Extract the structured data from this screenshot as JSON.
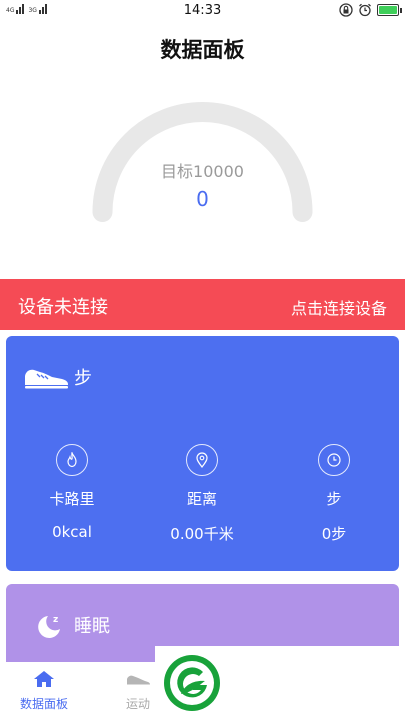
{
  "status_bar": {
    "network_labels": [
      "4G",
      "3G"
    ],
    "time": "14:33"
  },
  "header": {
    "title": "数据面板"
  },
  "gauge": {
    "target_label": "目标10000",
    "current_value": "0",
    "progress": 0
  },
  "connection": {
    "status": "设备未连接",
    "action": "点击连接设备"
  },
  "steps_card": {
    "title": "步",
    "stats": [
      {
        "label": "卡路里",
        "value": "0kcal",
        "icon": "flame-icon"
      },
      {
        "label": "距离",
        "value": "0.00千米",
        "icon": "location-pin-icon"
      },
      {
        "label": "步",
        "value": "0步",
        "icon": "clock-icon"
      }
    ]
  },
  "sleep_card": {
    "title": "睡眠"
  },
  "bottom_nav": {
    "items": [
      {
        "label": "数据面板",
        "icon": "home-icon",
        "active": true
      },
      {
        "label": "运动",
        "icon": "shoe-icon",
        "active": false
      }
    ]
  },
  "colors": {
    "accent": "#4a6cf0",
    "banner": "#f54b55",
    "steps_card": "#4d6ff0",
    "sleep_card": "#b092e8"
  }
}
